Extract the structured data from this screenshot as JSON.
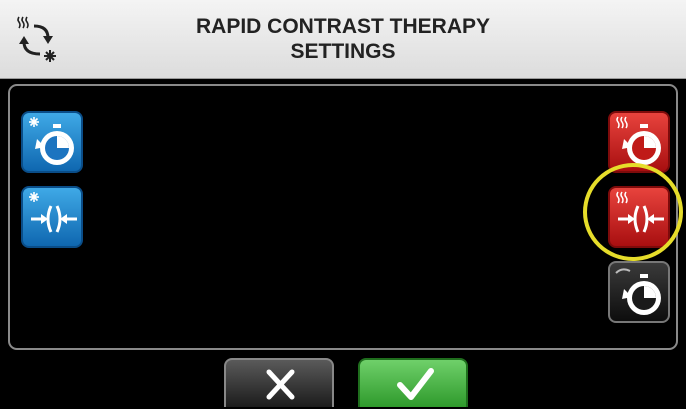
{
  "header": {
    "title_line1": "RAPID CONTRAST THERAPY",
    "title_line2": "SETTINGS",
    "mode_icon": "hot-cold-cycle-icon"
  },
  "left_controls": [
    {
      "name": "cold-timer-button",
      "icon": "snowflake-timer-icon",
      "color": "#1f7fcb"
    },
    {
      "name": "cold-compression-button",
      "icon": "snowflake-compression-icon",
      "color": "#1f7fcb"
    }
  ],
  "right_controls": [
    {
      "name": "heat-timer-button",
      "icon": "heat-timer-icon",
      "color": "#d2231f"
    },
    {
      "name": "heat-compression-button",
      "icon": "heat-compression-icon",
      "color": "#d2231f",
      "highlighted": true
    },
    {
      "name": "cycle-timer-button",
      "icon": "cycle-timer-icon",
      "color": "#1a1a1a"
    }
  ],
  "actions": {
    "cancel_icon": "close-icon",
    "confirm_icon": "checkmark-icon",
    "highlight_color": "#e6dd2a"
  }
}
